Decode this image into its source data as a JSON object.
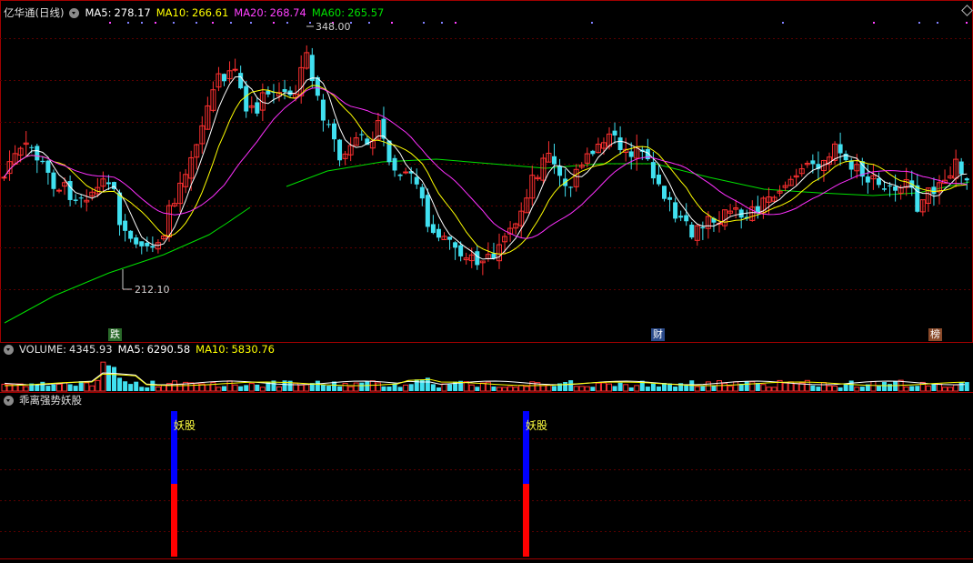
{
  "header": {
    "stock_name": "亿华通",
    "period": "(日线)",
    "ma5_label": "MA5:",
    "ma5_value": "278.17",
    "ma10_label": "MA10:",
    "ma10_value": "266.61",
    "ma20_label": "MA20:",
    "ma20_value": "268.74",
    "ma60_label": "MA60:",
    "ma60_value": "265.57"
  },
  "price_marks": {
    "high": "348.00",
    "low": "212.10"
  },
  "news_tags": [
    {
      "text": "跌",
      "color": "#2a6a2a"
    },
    {
      "text": "财",
      "color": "#2a4a8a"
    },
    {
      "text": "榜",
      "color": "#8a4a2a"
    }
  ],
  "volume_header": {
    "label": "VOLUME:",
    "value": "4345.93",
    "ma5_label": "MA5:",
    "ma5_value": "6290.58",
    "ma10_label": "MA10:",
    "ma10_value": "5830.76"
  },
  "indicator_header": {
    "title": "乖离强势妖股"
  },
  "signals": [
    {
      "label": "妖股"
    },
    {
      "label": "妖股"
    }
  ],
  "colors": {
    "up": "#ff3030",
    "down": "#40e0f0",
    "ma5": "#ffffff",
    "ma10": "#ffff00",
    "ma20": "#ff30ff",
    "ma60": "#00e000",
    "grid": "#5a0000",
    "signal_top": "#0000ff",
    "signal_bottom": "#ff0000"
  }
}
